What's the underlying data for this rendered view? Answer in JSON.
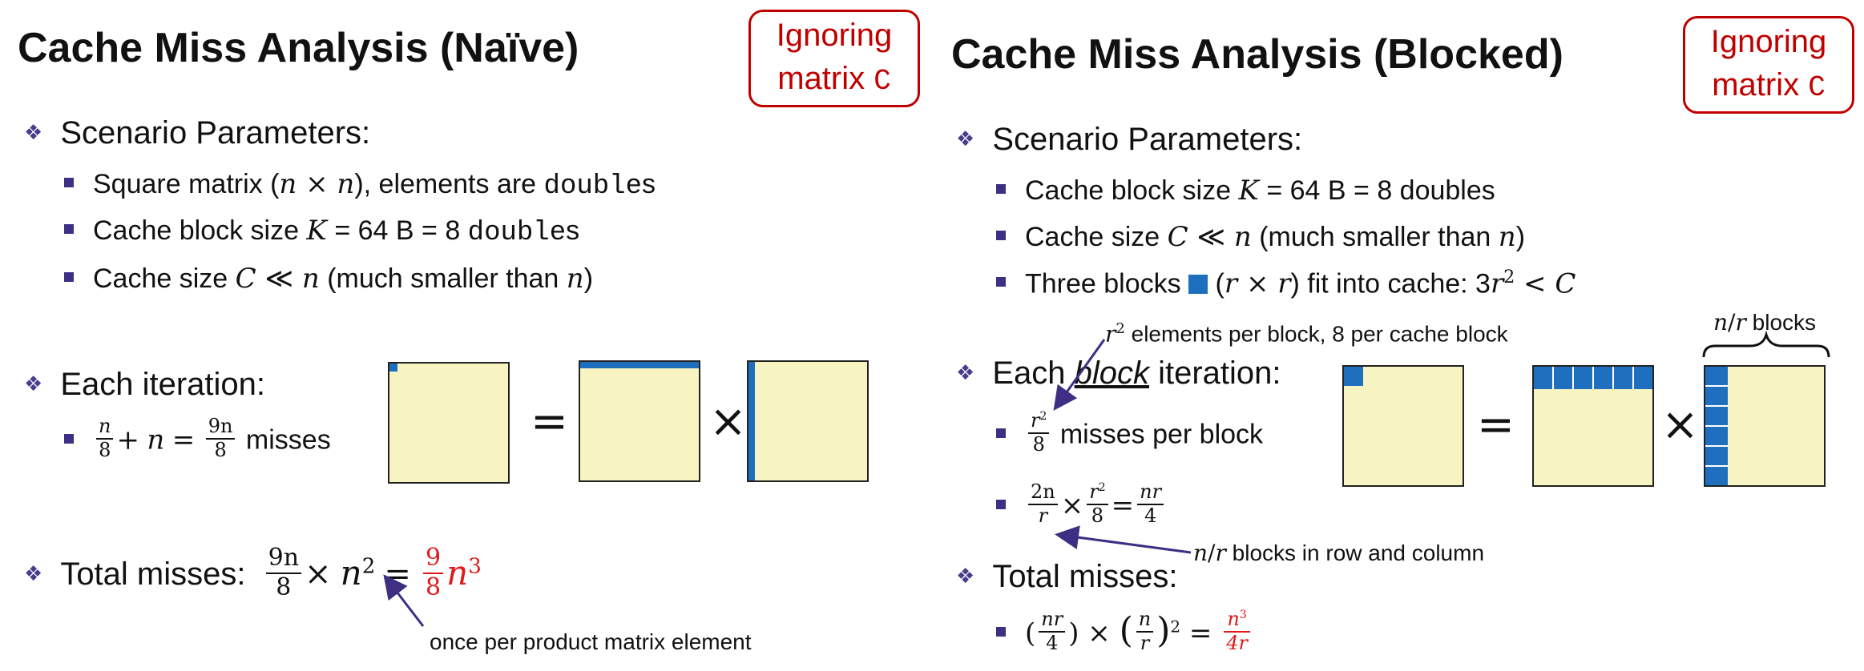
{
  "colors": {
    "accent_blue": "#1f6fbf",
    "matrix_fill": "#f7f4c2",
    "red": "#e31818",
    "badge_red": "#c00000",
    "arrow_purple": "#3e2f84"
  },
  "left": {
    "title": "Cache Miss Analysis (Naïve)",
    "badge_line1": "Ignoring",
    "badge_line2": "matrix ",
    "badge_code": "C",
    "scenario_heading": "Scenario Parameters:",
    "p1": {
      "a": "Square matrix (",
      "n1": "n",
      "x": " × ",
      "n2": "n",
      "b": "), elements are ",
      "code": "double",
      "c": "s"
    },
    "p2": {
      "a": "Cache block size ",
      "K": "K",
      "b": " = 64 B = 8 ",
      "code": "double",
      "c": "s"
    },
    "p3": {
      "a": "Cache size ",
      "C": "C",
      "ll": " ≪ ",
      "n": "n",
      "b": " (much smaller than ",
      "n2": "n",
      "c": ")"
    },
    "iter_heading": "Each iteration:",
    "iter": {
      "f1n": "n",
      "f1d": "8",
      "plus": "+",
      "n": "n",
      "eq": "=",
      "f2n": "9n",
      "f2d": "8",
      "tail": " misses"
    },
    "eq_sign": "=",
    "times_sign": "×",
    "total_label": "Total misses:",
    "total": {
      "fn": "9n",
      "fd": "8",
      "times": "×",
      "n2": "n",
      "sup": "2",
      "eq": "=",
      "rn": "9",
      "rd": "8",
      "rn3": "n",
      "rsup": "3"
    },
    "total_note": "once per product matrix element"
  },
  "right": {
    "title": "Cache Miss Analysis (Blocked)",
    "badge_line1": "Ignoring",
    "badge_line2": "matrix ",
    "badge_code": "C",
    "scenario_heading": "Scenario Parameters:",
    "p1": {
      "a": "Cache block size ",
      "K": "K",
      "b": " = 64 B = 8 doubles"
    },
    "p2": {
      "a": "Cache size ",
      "C": "C",
      "ll": " ≪ ",
      "n": "n",
      "b": " (much smaller than ",
      "n2": "n",
      "c": ")"
    },
    "p3": {
      "a": "Three blocks ",
      "b": " (",
      "r1": "r",
      "x": " × ",
      "r2": "r",
      "c": ") fit into cache:  3",
      "r3": "r",
      "sup": "2",
      "lt": " < ",
      "C": "C"
    },
    "r2_note": {
      "r": "r",
      "sup": "2",
      "text": " elements per block, 8 per cache block"
    },
    "iter_heading_a": "Each ",
    "iter_heading_block": "block",
    "iter_heading_b": " iteration:",
    "iter1": {
      "fn": "r",
      "fsup": "2",
      "fd": "8",
      "tail": " misses per block"
    },
    "iter2": {
      "f1n": "2n",
      "f1d": "r",
      "times": "×",
      "f2n": "r",
      "f2sup": "2",
      "f2d": "8",
      "eq": "=",
      "f3n": "nr",
      "f3d": "4"
    },
    "nr_blocks_label": {
      "n": "n",
      "slash": "/",
      "r": "r",
      "text": " blocks"
    },
    "row_col_note": {
      "n": "n",
      "slash": "/",
      "r": "r",
      "text": " blocks in row and column"
    },
    "total_label": "Total misses:",
    "total": {
      "lp": "(",
      "fn": "nr",
      "fd": "4",
      "rp": ")",
      "times": " × ",
      "lp2": "(",
      "gn": "n",
      "gd": "r",
      "rp2": ")",
      "sup": "2",
      "eq": " = ",
      "rn": "n",
      "rsup": "3",
      "rd": "4r"
    },
    "eq_sign": "=",
    "times_sign": "×"
  }
}
